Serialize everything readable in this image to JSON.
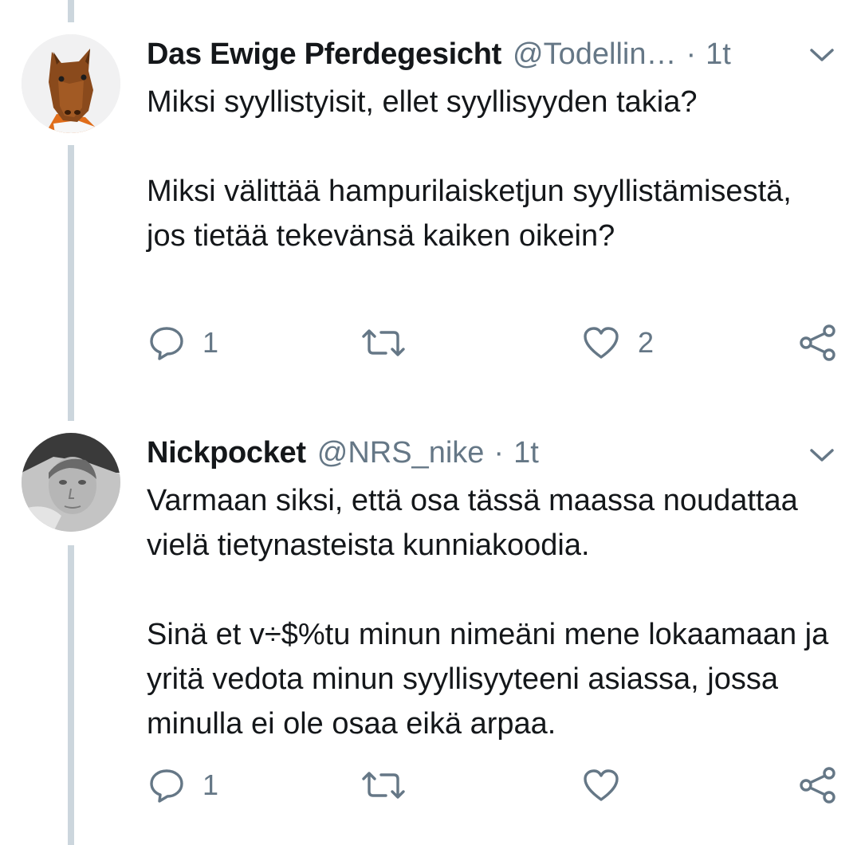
{
  "tweets": [
    {
      "display_name": "Das Ewige Pferdegesicht",
      "handle": "@Todellin…",
      "separator": "·",
      "time": "1t",
      "paragraphs": [
        "Miksi syyllistyisit, ellet syyllisyyden takia?",
        "Miksi välittää hampurilaisketjun syyllistämisestä, jos tietää tekevänsä kaiken oikein?"
      ],
      "reply_count": "1",
      "retweet_count": "",
      "like_count": "2",
      "avatar_icon": "horse-mask-avatar"
    },
    {
      "display_name": "Nickpocket",
      "handle": "@NRS_nike",
      "separator": "·",
      "time": "1t",
      "paragraphs": [
        "Varmaan siksi, että osa tässä maassa noudattaa vielä tietynasteista kunniakoodia.",
        "Sinä et v÷$%tu minun nimeäni mene lokaamaan ja yritä vedota minun syyllisyyteeni asiassa, jossa minulla ei ole osaa eikä arpaa."
      ],
      "reply_count": "1",
      "retweet_count": "",
      "like_count": "",
      "avatar_icon": "grayscale-photo-avatar"
    }
  ],
  "icons": {
    "reply": "reply-icon",
    "retweet": "retweet-icon",
    "like": "heart-icon",
    "share": "share-icon",
    "more": "chevron-down-icon"
  },
  "colors": {
    "text": "#14171a",
    "muted": "#657786",
    "thread_line": "#ccd6dd"
  }
}
